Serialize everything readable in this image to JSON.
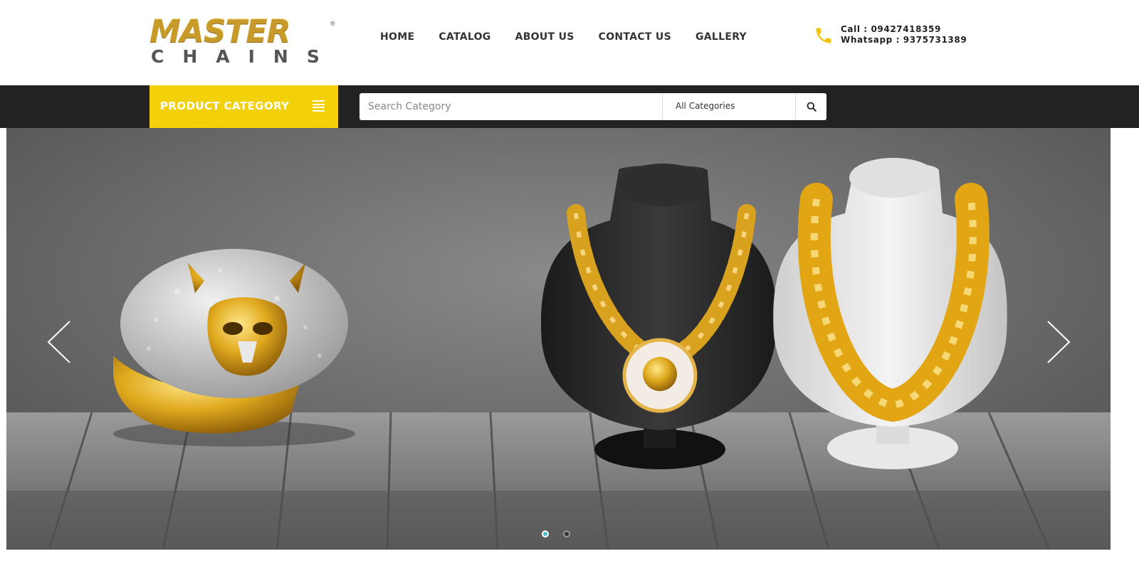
{
  "header": {
    "logo": {
      "top": "MASTER",
      "bottom": "CHAINS",
      "reg": "®"
    },
    "nav": [
      "HOME",
      "CATALOG",
      "ABOUT US",
      "CONTACT US",
      "GALLERY"
    ],
    "contact": {
      "call": "Call : 09427418359",
      "whatsapp": "Whatsapp : 9375731389",
      "icon": "phone-icon"
    }
  },
  "category_bar": {
    "button_label": "PRODUCT CATEGORY",
    "menu_icon": "menu-icon",
    "search_placeholder": "Search Category",
    "select_value": "All Categories",
    "search_icon": "search-icon"
  },
  "slider": {
    "prev_icon": "chevron-left-icon",
    "next_icon": "chevron-right-icon",
    "slides_total": 2,
    "active_slide": 1
  },
  "colors": {
    "accent_yellow": "#f2d00a",
    "dark_bar": "#222222",
    "gold": "#c79a2a",
    "dot_active": "#46c1d6"
  }
}
